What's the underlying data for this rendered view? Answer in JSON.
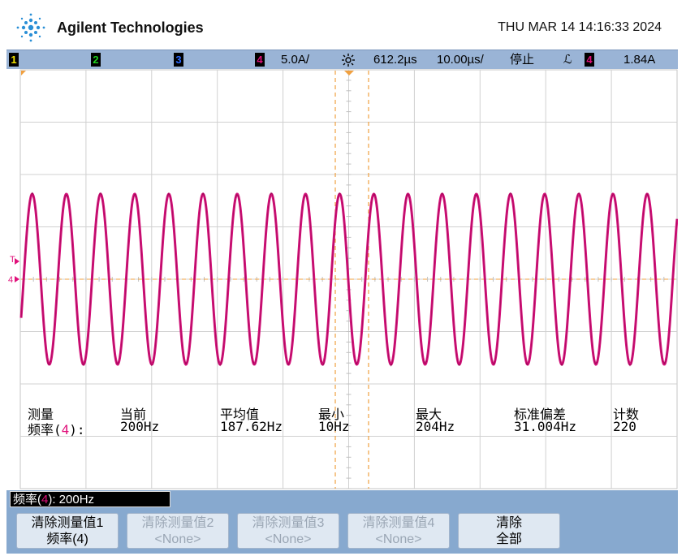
{
  "header": {
    "brand": "Agilent Technologies",
    "datetime": "THU MAR 14 14:16:33 2024"
  },
  "statusbar": {
    "channels": [
      "1",
      "2",
      "3",
      "4"
    ],
    "ch4_scale": "5.0A/",
    "trigger_delay": "612.2µs",
    "timebase": "10.00µs/",
    "run_state": "停止",
    "trigger_slope": "ℒ",
    "trigger_source": "4",
    "trigger_level": "1.84A",
    "colors": {
      "ch1": "#f2e300",
      "ch2": "#1ed11e",
      "ch3": "#2d6bff",
      "ch4": "#e0107a"
    }
  },
  "screen": {
    "markers": {
      "trigger": "T",
      "ch4": "4"
    },
    "signal": {
      "cycles": 19.2,
      "color": "#d4127a",
      "amplitude_fraction": 0.64
    }
  },
  "measurements": {
    "headers": {
      "label": "测量",
      "current": "当前",
      "mean": "平均值",
      "min": "最小",
      "max": "最大",
      "stddev": "标准偏差",
      "count": "计数"
    },
    "row": {
      "label_prefix": "频率(",
      "label_ch": "4",
      "label_suffix": "):",
      "current": "200Hz",
      "mean": "187.62Hz",
      "min": "10Hz",
      "max": "204Hz",
      "stddev": "31.004Hz",
      "count": "220"
    }
  },
  "bottom": {
    "status_prefix": "频率(",
    "status_ch": "4",
    "status_suffix": "): 200Hz",
    "softkeys": [
      {
        "line1": "清除测量值1",
        "line2": "频率(4)"
      },
      {
        "line1": "清除测量值2",
        "line2": "<None>"
      },
      {
        "line1": "清除测量值3",
        "line2": "<None>"
      },
      {
        "line1": "清除测量值4",
        "line2": "<None>"
      },
      {
        "line1": "清除",
        "line2": "全部"
      }
    ]
  }
}
